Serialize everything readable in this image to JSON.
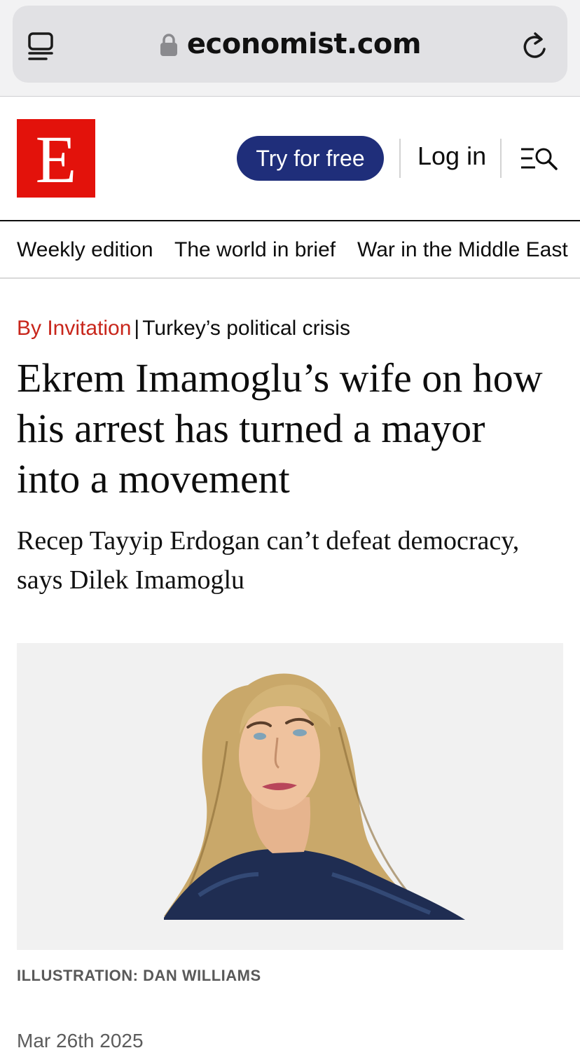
{
  "browser": {
    "url": "economist.com"
  },
  "header": {
    "logo_letter": "E",
    "try_label": "Try for free",
    "login_label": "Log in"
  },
  "nav": {
    "items": [
      {
        "label": "Weekly edition"
      },
      {
        "label": "The world in brief"
      },
      {
        "label": "War in the Middle East"
      }
    ]
  },
  "article": {
    "section": "By Invitation",
    "separator": "|",
    "topic": "Turkey’s political crisis",
    "headline": "Ekrem Imamoglu’s wife on how his arrest has turned a mayor into a movement",
    "standfirst": "Recep Tayyip Erdogan can’t defeat democracy, says Dilek Imamoglu",
    "image_caption": "ILLUSTRATION: DAN WILLIAMS",
    "date": "Mar 26th 2025"
  },
  "colors": {
    "brand_red": "#e3120b",
    "button_blue": "#1f2e7a",
    "kicker_red": "#c8261b"
  },
  "icons": [
    "reader-view-icon",
    "lock-icon",
    "reload-icon",
    "menu-search-icon"
  ]
}
